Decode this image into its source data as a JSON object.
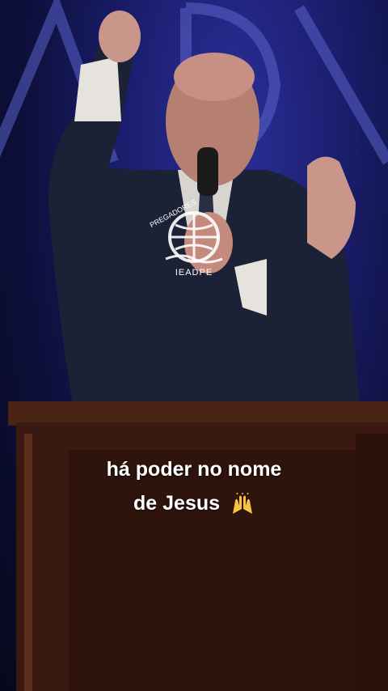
{
  "caption": {
    "line1": "há poder no nome",
    "line2": "de Jesus",
    "emoji": "raising-hands-emoji"
  },
  "watermark": {
    "top_text": "PREGADORES",
    "bottom_text": "IEADPE"
  },
  "colors": {
    "background": "#1a1d6a",
    "pulpit": "#3a1a10",
    "suit": "#1c2236"
  }
}
